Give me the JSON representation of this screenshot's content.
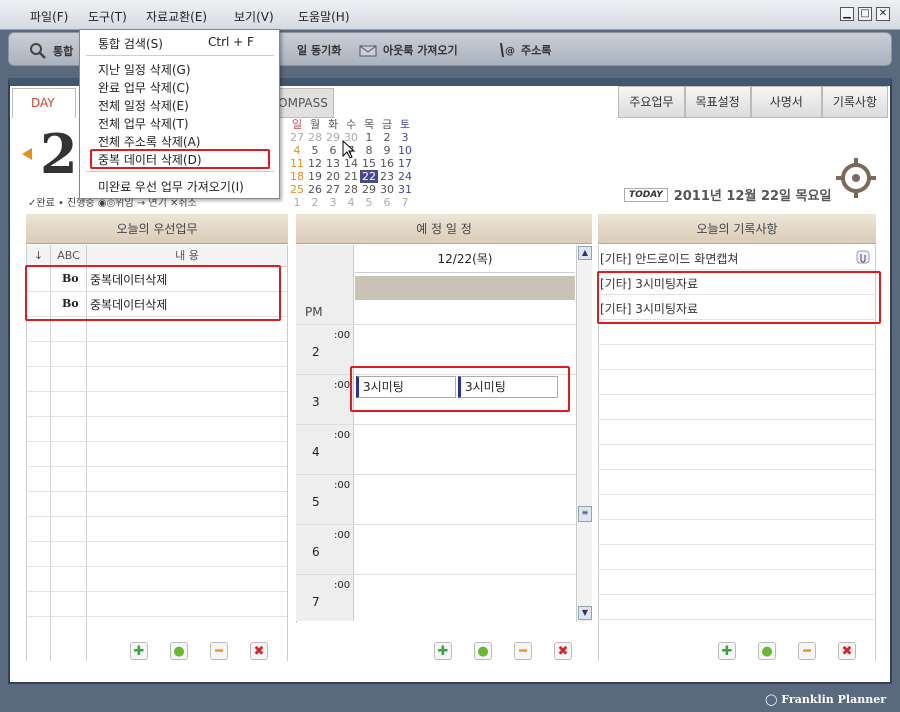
{
  "menu": {
    "items": [
      "파일(F)",
      "도구(T)",
      "자료교환(E)",
      "보기(V)",
      "도움말(H)"
    ]
  },
  "window_buttons": [
    "▁",
    "□",
    "✕"
  ],
  "toolbar": {
    "search": "통합",
    "sync": "일 동기화",
    "outlook": "아웃룩 가져오기",
    "addressbook": "주소록"
  },
  "dropdown": {
    "items": [
      {
        "label": "통합 검색(S)",
        "shortcut": "Ctrl + F"
      },
      {
        "label": "지난 일정 삭제(G)"
      },
      {
        "label": "완료 업무 삭제(C)"
      },
      {
        "label": "전체 일정 삭제(E)"
      },
      {
        "label": "전체 업무 삭제(T)"
      },
      {
        "label": "전체 주소록 삭제(A)"
      },
      {
        "label": "중복 데이터 삭제(D)"
      },
      {
        "label": "미완료 우선 업무 가져오기(I)"
      }
    ]
  },
  "tabs": {
    "day": "DAY",
    "compass": "OMPASS",
    "right": [
      "주요업무",
      "목표설정",
      "사명서",
      "기록사항"
    ]
  },
  "date": {
    "big_day": "2",
    "today_badge": "TODAY",
    "today_text": "2011년 12월 22일 목요일"
  },
  "legend": "✓완료 • 진행중 ◉◎위임 → 연기 ✕취소",
  "calendar": {
    "weekdays": [
      "일",
      "월",
      "화",
      "수",
      "목",
      "금",
      "토"
    ],
    "weeks": [
      [
        "27",
        "28",
        "29",
        "30",
        "1",
        "2",
        "3"
      ],
      [
        "4",
        "5",
        "6",
        "7",
        "8",
        "9",
        "10"
      ],
      [
        "11",
        "12",
        "13",
        "14",
        "15",
        "16",
        "17"
      ],
      [
        "18",
        "19",
        "20",
        "21",
        "22",
        "23",
        "24"
      ],
      [
        "25",
        "26",
        "27",
        "28",
        "29",
        "30",
        "31"
      ],
      [
        "1",
        "2",
        "3",
        "4",
        "5",
        "6",
        "7"
      ]
    ],
    "selected": "22"
  },
  "priority": {
    "title": "오늘의 우선업무",
    "col_sort": "↓",
    "col_abc": "ABC",
    "col_content": "내 용",
    "tasks": [
      {
        "abc": "Bo",
        "text": "중복데이터삭제"
      },
      {
        "abc": "Bo",
        "text": "중복데이터삭제"
      }
    ]
  },
  "schedule": {
    "title": "예 정 일 정",
    "date_header": "12/22(목)",
    "pm": "PM",
    "min_label": ":00",
    "hours": [
      "2",
      "3",
      "4",
      "5",
      "6",
      "7"
    ],
    "events": [
      "3시미팅",
      "3시미팅"
    ]
  },
  "records": {
    "title": "오늘의 기록사항",
    "items": [
      "[기타] 안드로이드 화면캡쳐",
      "[기타] 3시미팅자료",
      "[기타] 3시미팅자료"
    ]
  },
  "footer": "Franklin Planner",
  "colors": {
    "accent_orange": "#e2901c",
    "highlight_red": "#e01d1d",
    "selected_day_bg": "#4a4a8a"
  }
}
